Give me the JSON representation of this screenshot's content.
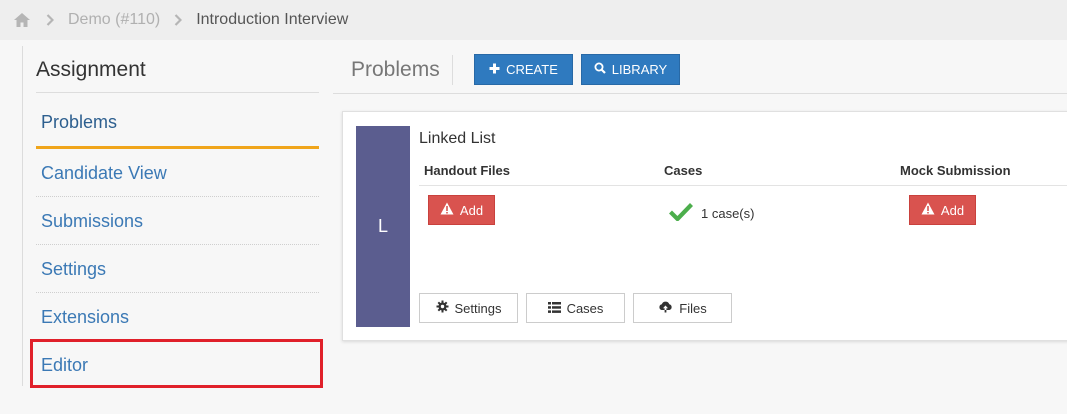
{
  "breadcrumb": {
    "items": [
      "Demo (#110)",
      "Introduction Interview"
    ]
  },
  "sidebar": {
    "title": "Assignment",
    "items": [
      {
        "label": "Problems",
        "active": true
      },
      {
        "label": "Candidate View"
      },
      {
        "label": "Submissions"
      },
      {
        "label": "Settings"
      },
      {
        "label": "Extensions"
      },
      {
        "label": "Editor"
      }
    ]
  },
  "header": {
    "title": "Problems",
    "create_label": "CREATE",
    "library_label": "LIBRARY"
  },
  "problem": {
    "letter": "L",
    "name": "Linked List",
    "columns": {
      "handout": "Handout Files",
      "cases": "Cases",
      "mock": "Mock Submission"
    },
    "handout_add": "Add",
    "cases_value": "1 case(s)",
    "mock_add": "Add",
    "buttons": {
      "settings": "Settings",
      "cases": "Cases",
      "files": "Files"
    }
  },
  "colors": {
    "primary": "#2f7abf",
    "danger": "#d9534f",
    "accent": "#f0a51b",
    "highlight": "#e0202a",
    "letter_bg": "#5b5d8f",
    "success": "#4cae4c"
  }
}
